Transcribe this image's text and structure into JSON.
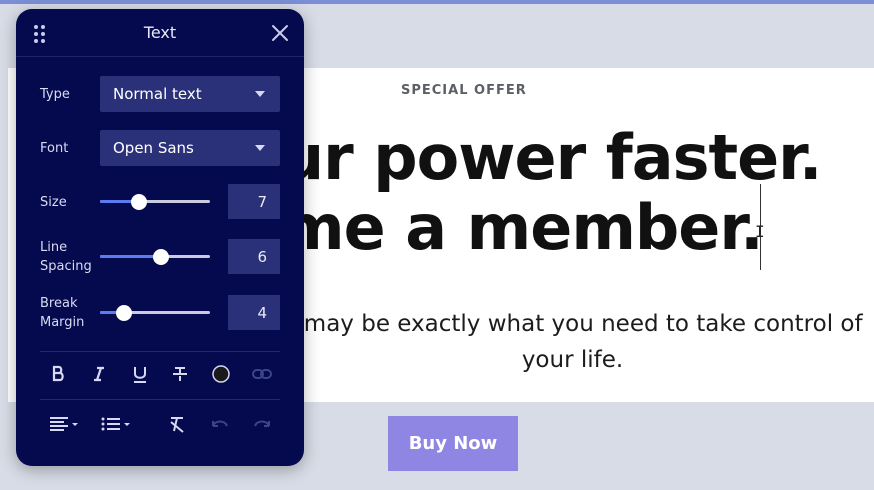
{
  "page": {
    "eyebrow": "SPECIAL OFFER",
    "headline_line1": "ur power faster.",
    "headline_line2": "me a member.",
    "paragraph": "o may be exactly what you need to take control of your life.",
    "buy_button": "Buy Now"
  },
  "panel": {
    "title": "Text",
    "type": {
      "label": "Type",
      "value": "Normal text"
    },
    "font": {
      "label": "Font",
      "value": "Open Sans"
    },
    "size": {
      "label": "Size",
      "value": "7",
      "level": 0.35
    },
    "line_spacing": {
      "label": "Line Spacing",
      "value": "6",
      "level": 0.55
    },
    "break_margin": {
      "label": "Break Margin",
      "value": "4",
      "level": 0.22
    },
    "format_tools": [
      "bold-icon",
      "italic-icon",
      "underline-icon",
      "strikethrough-icon",
      "text-color-icon",
      "link-icon"
    ],
    "paragraph_tools": [
      "align-icon",
      "list-icon",
      "clear-format-icon",
      "undo-icon",
      "redo-icon"
    ]
  },
  "colors": {
    "panel_bg": "#050a4f",
    "accent": "#5a7cf0",
    "button": "#8f86e3"
  }
}
